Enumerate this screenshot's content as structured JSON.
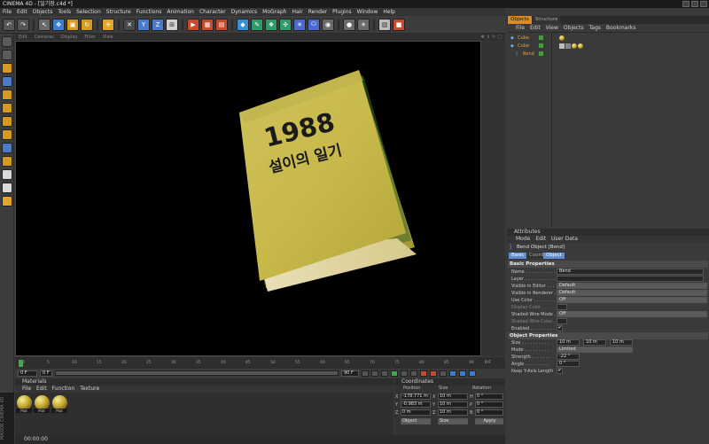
{
  "window": {
    "title": "CINEMA 4D - [일기장.c4d *]"
  },
  "menubar": [
    "File",
    "Edit",
    "Objects",
    "Tools",
    "Selection",
    "Structure",
    "Functions",
    "Animation",
    "Character",
    "Dynamics",
    "MoGraph",
    "Hair",
    "Render",
    "Plugins",
    "Window",
    "Help"
  ],
  "viewport": {
    "menu": [
      "Edit",
      "Cameras",
      "Display",
      "Filter",
      "View"
    ],
    "book_title_line1": "1988",
    "book_title_line2": "설이의 일기"
  },
  "timeline": {
    "ticks": [
      "0",
      "5",
      "10",
      "15",
      "20",
      "25",
      "30",
      "35",
      "40",
      "45",
      "50",
      "55",
      "60",
      "65",
      "70",
      "75",
      "80",
      "85",
      "90"
    ],
    "end_label": "0 F",
    "current_frame": "0 F",
    "start_field": "0 F",
    "end_field": "90 F"
  },
  "materials": {
    "header": "Materials",
    "menu": [
      "File",
      "Edit",
      "Function",
      "Texture"
    ],
    "swatches": [
      "Mat",
      "Mat",
      "Mat"
    ]
  },
  "coordinates": {
    "header": "Coordinates",
    "cols": [
      "Position",
      "Size",
      "Rotation"
    ],
    "rows": [
      {
        "axis": "X",
        "pos": "-178.771 m",
        "size_axis": "X",
        "size": "10 m",
        "rot_axis": "H",
        "rot": "0 °"
      },
      {
        "axis": "Y",
        "pos": "-0.983 m",
        "size_axis": "Y",
        "size": "10 m",
        "rot_axis": "P",
        "rot": "0 °"
      },
      {
        "axis": "Z",
        "pos": "0 m",
        "size_axis": "Z",
        "size": "10 m",
        "rot_axis": "B",
        "rot": "0 °"
      }
    ],
    "mode_object": "Object",
    "mode_size": "Size",
    "apply": "Apply"
  },
  "status": "00:00:00",
  "logo_text": "MAXON CINEMA 4D",
  "objects_panel": {
    "tabs": [
      "Objects",
      "Structure"
    ],
    "menu": [
      "File",
      "Edit",
      "View",
      "Objects",
      "Tags",
      "Bookmarks"
    ],
    "items": [
      {
        "name": "Cube"
      },
      {
        "name": "Cube"
      },
      {
        "name": "Bend"
      }
    ]
  },
  "attributes": {
    "header": "Attributes",
    "menu": [
      "Mode",
      "Edit",
      "User Data"
    ],
    "object_title": "Bend Object [Bend]",
    "tabs": [
      "Basic",
      "Coord.",
      "Object"
    ],
    "basic_section": "Basic Properties",
    "basic": [
      {
        "label": "Name . . . . . . . . . . .",
        "value": "Bend"
      },
      {
        "label": "Layer . . . . . . . . . . .",
        "value": ""
      },
      {
        "label": "Visible in Editor . . .",
        "value": "Default"
      },
      {
        "label": "Visible in Renderer . .",
        "value": "Default"
      },
      {
        "label": "Use Color . . . . . . . .",
        "value": "Off"
      },
      {
        "label": "Display Color . . . . . .",
        "value": ""
      },
      {
        "label": "Shaded Wire Mode . .",
        "value": "Off"
      },
      {
        "label": "Shaded Wire Color . .",
        "value": ""
      },
      {
        "label": "Enabled . . . . . . . . .",
        "value": "✔"
      }
    ],
    "object_section": "Object Properties",
    "object_props": [
      {
        "label": "Size . . . . . . . . . .",
        "value": "10 m",
        "value2": "10 m",
        "value3": "10 m"
      },
      {
        "label": "Mode . . . . . . . . .",
        "value": "Limited"
      },
      {
        "label": "Strength . . . . . . .",
        "value": "-22 °"
      },
      {
        "label": "Angle . . . . . . . . .",
        "value": "0 °"
      },
      {
        "label": "Keep Y-Axis Length",
        "value": "✔"
      }
    ]
  }
}
